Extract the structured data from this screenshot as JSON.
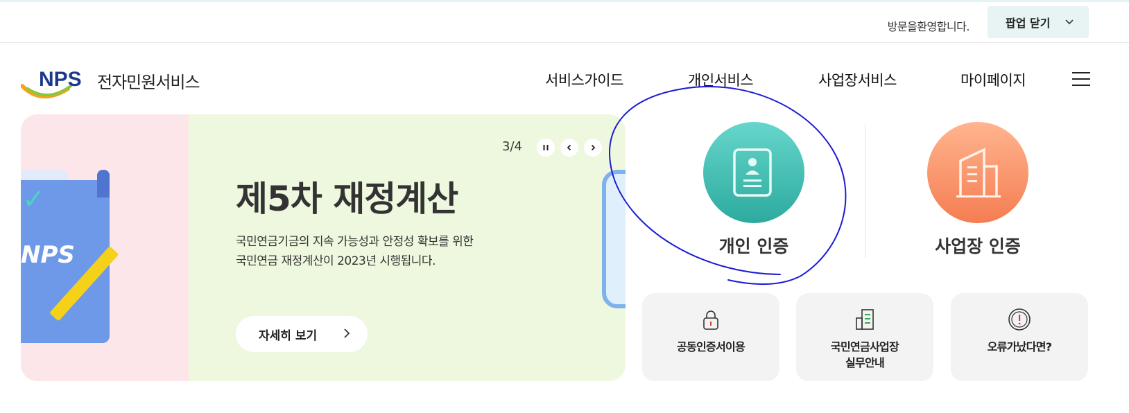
{
  "topbar": {
    "welcome": "방문을환영합니다.",
    "popup_close": "팝업 닫기"
  },
  "header": {
    "logo_text": "전자민원서비스",
    "logo_mark": "NPS",
    "nav": [
      "서비스가이드",
      "개인서비스",
      "사업장서비스",
      "마이페이지"
    ]
  },
  "banner": {
    "counter": "3/4",
    "title": "제5차 재정계산",
    "desc_line1": "국민연금기금의 지속 가능성과 안정성 확보를 위한",
    "desc_line2": "국민연금 재정계산이 2023년 시행됩니다.",
    "more": "자세히 보기",
    "illustration_text": "NPS"
  },
  "auth": {
    "personal": "개인 인증",
    "business": "사업장 인증"
  },
  "quick": {
    "cert": "공동인증서이용",
    "guide_line1": "국민연금사업장",
    "guide_line2": "실무안내",
    "error": "오류가났다면?"
  },
  "colors": {
    "teal": "#2daa9e",
    "orange": "#f57d52",
    "annotation": "#1a1ad6"
  }
}
